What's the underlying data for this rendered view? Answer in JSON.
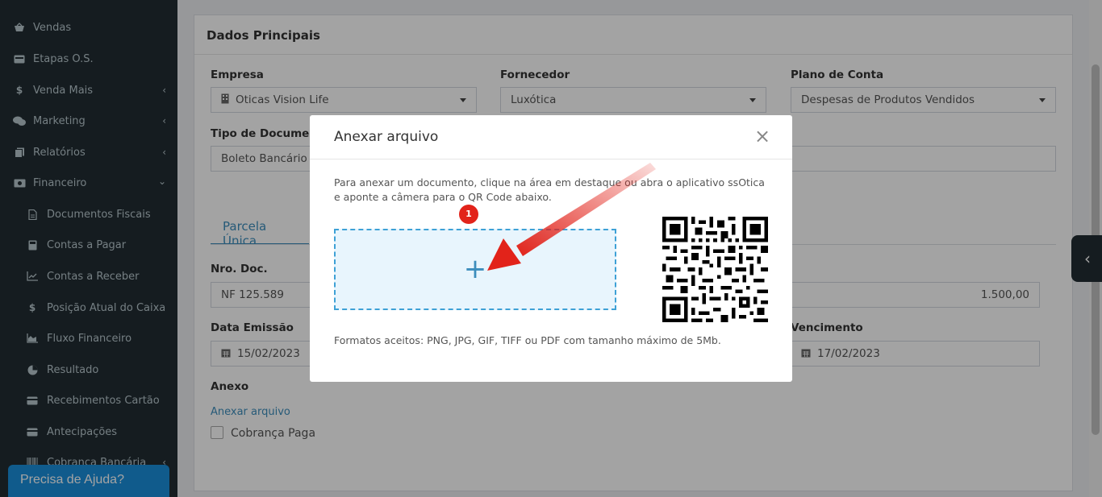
{
  "sidebar": {
    "items": [
      {
        "label": "Vendas",
        "icon": "basket-icon"
      },
      {
        "label": "Etapas O.S.",
        "icon": "card-icon"
      },
      {
        "label": "Venda Mais",
        "icon": "dollar-icon"
      },
      {
        "label": "Marketing",
        "icon": "chat-icon"
      },
      {
        "label": "Relatórios",
        "icon": "copy-icon"
      },
      {
        "label": "Financeiro",
        "icon": "money-icon"
      }
    ],
    "subitems": [
      {
        "label": "Documentos Fiscais",
        "icon": "file-icon"
      },
      {
        "label": "Contas a Pagar",
        "icon": "calculator-icon"
      },
      {
        "label": "Contas a Receber",
        "icon": "line-chart-icon"
      },
      {
        "label": "Posição Atual do Caixa",
        "icon": "dollar-icon"
      },
      {
        "label": "Fluxo Financeiro",
        "icon": "area-chart-icon"
      },
      {
        "label": "Resultado",
        "icon": "pie-chart-icon"
      },
      {
        "label": "Recebimentos Cartão",
        "icon": "credit-card-icon"
      },
      {
        "label": "Antecipações",
        "icon": "credit-card-icon"
      },
      {
        "label": "Cobrança Bancária",
        "icon": "barcode-icon"
      }
    ],
    "help_label": "Precisa de Ajuda?"
  },
  "form": {
    "section_title": "Dados Principais",
    "empresa_label": "Empresa",
    "empresa_value": "Oticas Vision Life",
    "fornecedor_label": "Fornecedor",
    "fornecedor_value": "Luxótica",
    "plano_label": "Plano de Conta",
    "plano_value": "Despesas de Produtos Vendidos",
    "tipo_label": "Tipo de Documento",
    "tipo_value": "Boleto Bancário",
    "tab_label": "Parcela Única",
    "nro_label": "Nro. Doc.",
    "nro_value": "NF 125.589",
    "valor_value": "1.500,00",
    "emissao_label": "Data Emissão",
    "emissao_value": "15/02/2023",
    "vencimento_label": "Vencimento",
    "vencimento_value": "17/02/2023",
    "anexo_label": "Anexo",
    "anexo_link": "Anexar arquivo",
    "cobranca_label": "Cobrança Paga"
  },
  "modal": {
    "title": "Anexar arquivo",
    "close": "×",
    "description": "Para anexar um documento, clique na área em destaque ou abra o aplicativo ssOtica e aponte a câmera para o QR Code abaixo.",
    "plus": "+",
    "badge": "1",
    "formats": "Formatos aceitos: PNG, JPG, GIF, TIFF ou PDF com tamanho máximo de 5Mb."
  },
  "colors": {
    "sidebar_bg": "#222d32",
    "accent": "#3c8dbc",
    "help_bg": "#1a8fdb",
    "arrow_red": "#e2231a"
  }
}
